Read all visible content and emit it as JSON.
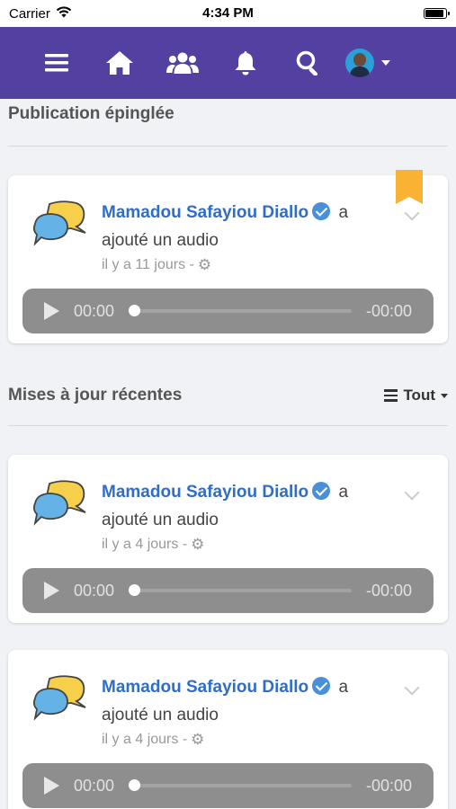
{
  "status_bar": {
    "carrier": "Carrier",
    "time": "4:34 PM",
    "battery_level": 0.85
  },
  "navbar": {
    "icons": [
      "menu-icon",
      "home-icon",
      "groups-icon",
      "bell-icon",
      "search-icon",
      "avatar"
    ],
    "color": "#5340a0"
  },
  "pinned": {
    "title": "Publication épinglée",
    "post": {
      "author": "Mamadou Safayiou Diallo",
      "suffix_a": "a",
      "action": "ajouté un audio",
      "time": "il y a 11 jours -",
      "audio": {
        "current": "00:00",
        "remaining": "-00:00"
      }
    }
  },
  "recent": {
    "title": "Mises à jour récentes",
    "filter_label": "Tout",
    "posts": [
      {
        "author": "Mamadou Safayiou Diallo",
        "suffix_a": "a",
        "action": "ajouté un audio",
        "time": "il y a 4 jours -",
        "audio": {
          "current": "00:00",
          "remaining": "-00:00"
        }
      },
      {
        "author": "Mamadou Safayiou Diallo",
        "suffix_a": "a",
        "action": "ajouté un audio",
        "time": "il y a 4 jours -",
        "audio": {
          "current": "00:00",
          "remaining": "-00:00"
        }
      }
    ]
  },
  "colors": {
    "accent_author": "#2f6dc8",
    "bookmark": "#f9b233",
    "audio_bg": "#8e8e8e"
  }
}
